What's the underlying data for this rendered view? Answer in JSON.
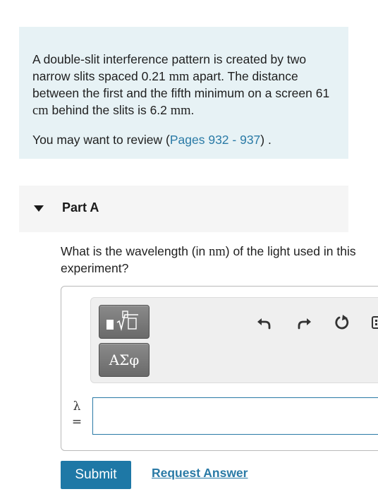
{
  "problem": {
    "text_1": "A double-slit interference pattern is created by two narrow slits spaced 0.21 ",
    "unit_mm_1": "mm",
    "text_2": " apart. The distance between the first and the fifth minimum on a screen 61 ",
    "unit_cm": "cm",
    "text_3": " behind the slits is 6.2 ",
    "unit_mm_2": "mm",
    "text_4": ".",
    "review_prefix": "You may want to review (",
    "review_link": "Pages 932 - 937",
    "review_suffix": ") ."
  },
  "part": {
    "title": "Part A"
  },
  "question": {
    "text_1": "What is the wavelength (in ",
    "unit": "nm",
    "text_2": ") of the light used in this experiment?"
  },
  "toolbar": {
    "templates_icon": "fraction-radical-icon",
    "symbols_label": "ΑΣφ",
    "undo_icon": "undo-icon",
    "redo_icon": "redo-icon",
    "reset_icon": "reset-icon",
    "keyboard_icon": "keyboard-icon"
  },
  "answer": {
    "variable": "λ",
    "equals": "=",
    "value": "",
    "placeholder": ""
  },
  "actions": {
    "submit_label": "Submit",
    "request_label": "Request Answer"
  },
  "colors": {
    "problem_bg": "#e7f2f5",
    "link": "#2a7aa6",
    "submit_bg": "#1e78a6"
  }
}
